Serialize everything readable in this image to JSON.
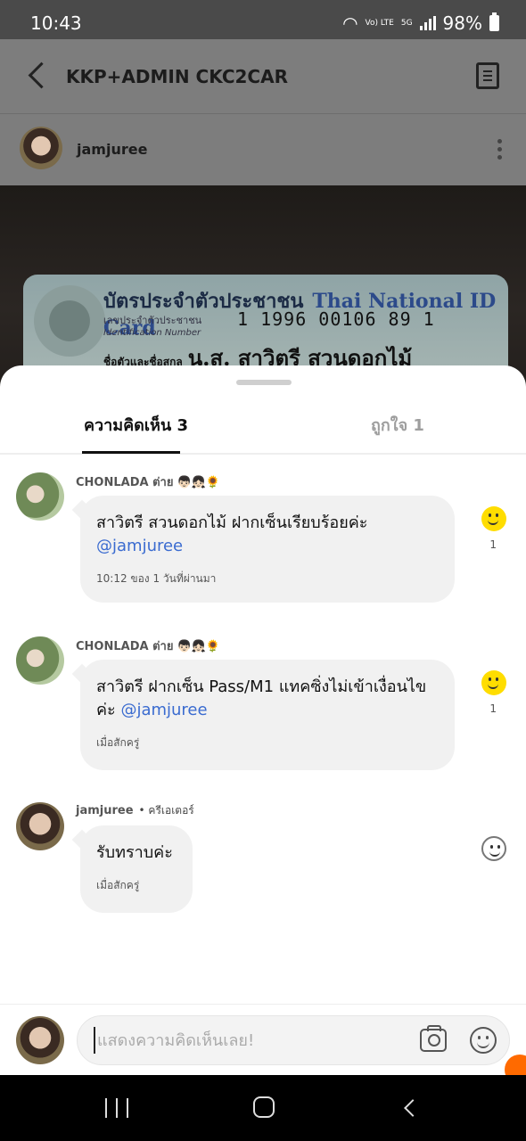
{
  "status_bar": {
    "time": "10:43",
    "network": "5G",
    "volte": "Vo) LTE",
    "battery": "98%"
  },
  "header": {
    "title": "KKP+ADMIN CKC2CAR"
  },
  "post": {
    "author": "jamjuree",
    "card": {
      "title_th": "บัตรประจำตัวประชาชน",
      "title_en": "Thai National ID Card",
      "id_label_th": "เลขประจำตัวประชาชน",
      "id_label_en": "Identification Number",
      "id_number": "1 1996 00106 89 1",
      "name_label": "ชื่อตัวและชื่อสกุล",
      "name": "น.ส. สาวิตรี สวนดอกไม้"
    }
  },
  "tabs": [
    {
      "label": "ความคิดเห็น 3",
      "active": true
    },
    {
      "label": "ถูกใจ 1",
      "active": false
    }
  ],
  "comments": [
    {
      "author": "CHONLADA ต่าย",
      "emoji": "👦🏻👧🏻🌻",
      "text": "สาวิตรี สวนดอกไม้ ฝากเซ็นเรียบร้อยค่ะ ",
      "mention": "@jamjuree",
      "time": "10:12 ของ 1 วันที่ผ่านมา",
      "likes": "1",
      "liked": true
    },
    {
      "author": "CHONLADA ต่าย",
      "emoji": "👦🏻👧🏻🌻",
      "text": "สาวิตรี ฝากเซ็น Pass/M1 แทคซิ่งไม่เข้าเงื่อนไขค่ะ ",
      "mention": "@jamjuree",
      "time": "เมื่อสักครู่",
      "likes": "1",
      "liked": true
    },
    {
      "author": "jamjuree",
      "badge": "• ครีเอเตอร์",
      "text": "รับทราบค่ะ",
      "time": "เมื่อสักครู่",
      "liked": false
    }
  ],
  "input": {
    "placeholder": "แสดงความคิดเห็นเลย!"
  }
}
